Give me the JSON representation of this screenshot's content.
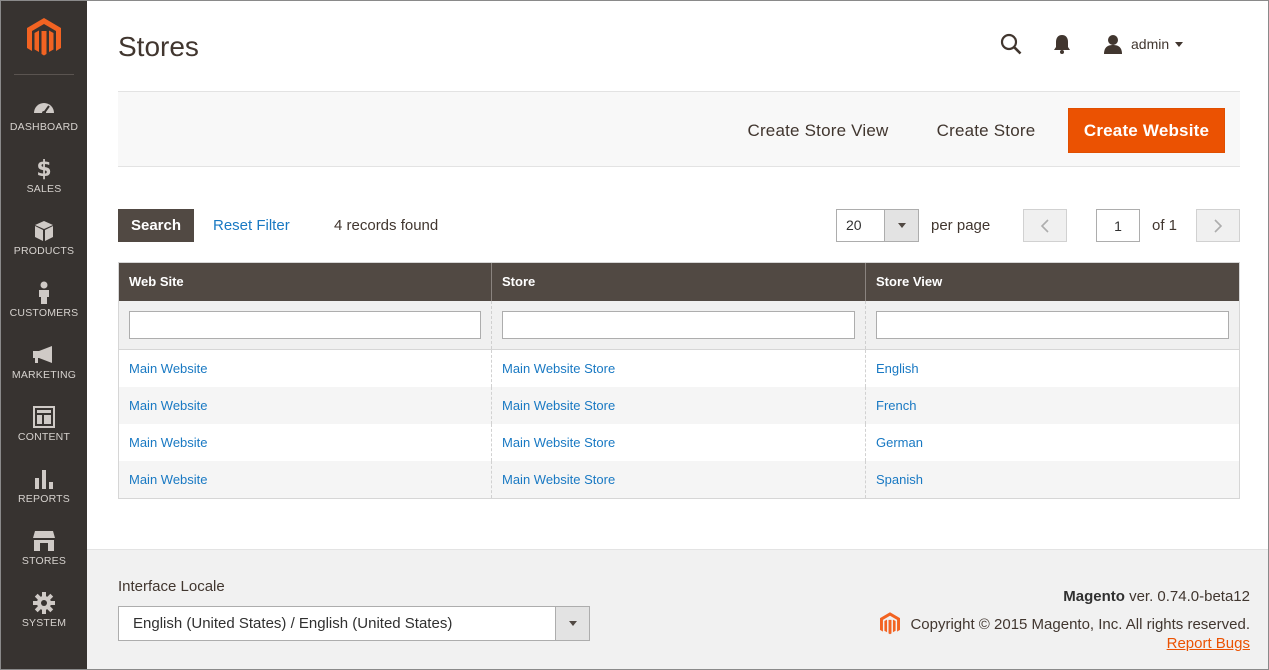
{
  "sidebar": {
    "brand": "magento-logo",
    "items": [
      {
        "label": "DASHBOARD",
        "icon": "dashboard-gauge-icon"
      },
      {
        "label": "SALES",
        "icon": "dollar-icon"
      },
      {
        "label": "PRODUCTS",
        "icon": "box-icon"
      },
      {
        "label": "CUSTOMERS",
        "icon": "person-icon"
      },
      {
        "label": "MARKETING",
        "icon": "megaphone-icon"
      },
      {
        "label": "CONTENT",
        "icon": "layout-icon"
      },
      {
        "label": "REPORTS",
        "icon": "bar-chart-icon"
      },
      {
        "label": "STORES",
        "icon": "storefront-icon"
      },
      {
        "label": "SYSTEM",
        "icon": "gear-icon"
      }
    ]
  },
  "header": {
    "title": "Stores",
    "user": "admin"
  },
  "actions": {
    "create_store_view": "Create Store View",
    "create_store": "Create Store",
    "create_website": "Create Website"
  },
  "grid_controls": {
    "search": "Search",
    "reset_filter": "Reset Filter",
    "records_found": "4 records found",
    "per_page_value": "20",
    "per_page_label": "per page",
    "current_page": "1",
    "of_pages": "of 1"
  },
  "table": {
    "columns": [
      "Web Site",
      "Store",
      "Store View"
    ],
    "rows": [
      [
        "Main Website",
        "Main Website Store",
        "English"
      ],
      [
        "Main Website",
        "Main Website Store",
        "French"
      ],
      [
        "Main Website",
        "Main Website Store",
        "German"
      ],
      [
        "Main Website",
        "Main Website Store",
        "Spanish"
      ]
    ]
  },
  "footer": {
    "locale_label": "Interface Locale",
    "locale_value": "English (United States) / English (United States)",
    "brand": "Magento",
    "version": " ver. 0.74.0-beta12",
    "copyright": "Copyright © 2015 Magento, Inc. All rights reserved.",
    "report_bugs": "Report Bugs"
  },
  "colors": {
    "sidebar_bg": "#373330",
    "accent": "#eb5202",
    "link": "#1979c3",
    "table_header": "#514943"
  }
}
